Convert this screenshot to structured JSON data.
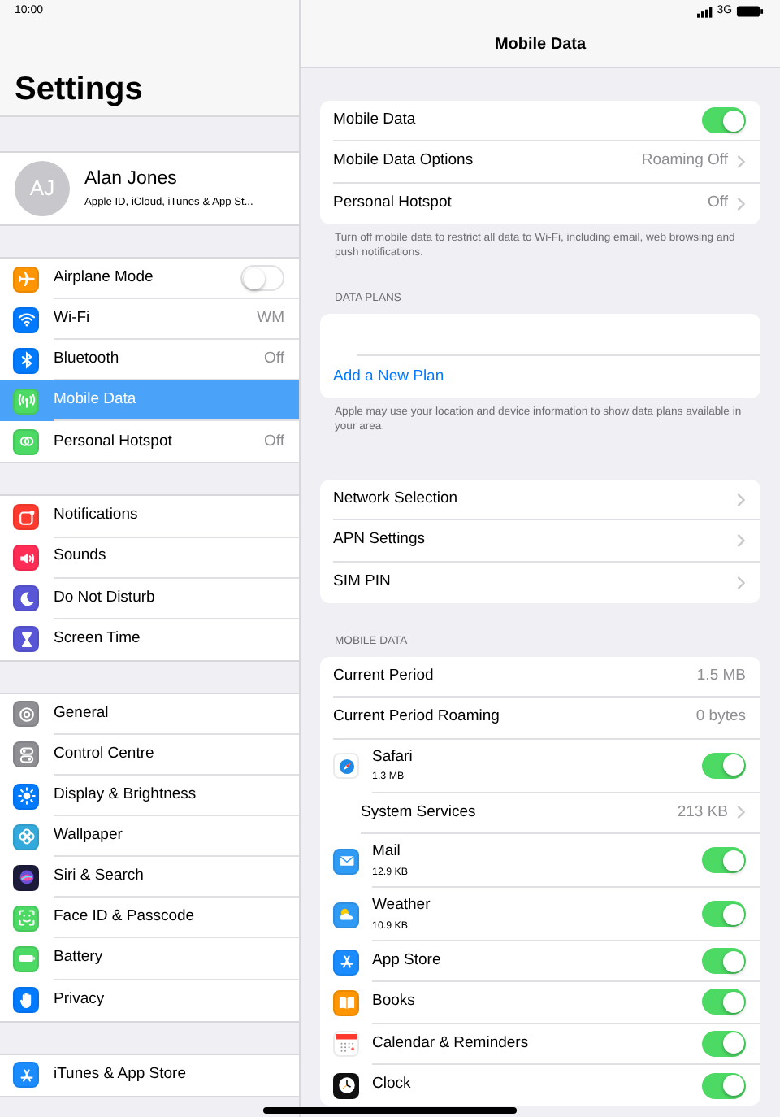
{
  "status_bar": {
    "time": "10:00",
    "network": "3G"
  },
  "sidebar": {
    "title": "Settings",
    "profile": {
      "initials": "AJ",
      "name": "Alan Jones",
      "subtitle": "Apple ID, iCloud, iTunes & App St..."
    },
    "groups": [
      [
        {
          "label": "Airplane Mode",
          "kind": "toggle",
          "on": false,
          "selected": false,
          "color": "#ff9500"
        },
        {
          "label": "Wi-Fi",
          "kind": "link",
          "value": "WM",
          "selected": false,
          "color": "#007aff"
        },
        {
          "label": "Bluetooth",
          "kind": "link",
          "value": "Off",
          "selected": false,
          "color": "#007aff"
        },
        {
          "label": "Mobile Data",
          "kind": "link",
          "selected": true,
          "color": "#4cd964"
        },
        {
          "label": "Personal Hotspot",
          "kind": "link",
          "value": "Off",
          "selected": false,
          "color": "#4cd964"
        }
      ],
      [
        {
          "label": "Notifications",
          "kind": "link",
          "selected": false,
          "color": "#ff3b30"
        },
        {
          "label": "Sounds",
          "kind": "link",
          "selected": false,
          "color": "#ff2d55"
        },
        {
          "label": "Do Not Disturb",
          "kind": "link",
          "selected": false,
          "color": "#5856d6"
        },
        {
          "label": "Screen Time",
          "kind": "link",
          "selected": false,
          "color": "#5856d6"
        }
      ],
      [
        {
          "label": "General",
          "kind": "link",
          "selected": false,
          "color": "#8e8e93"
        },
        {
          "label": "Control Centre",
          "kind": "link",
          "selected": false,
          "color": "#8e8e93"
        },
        {
          "label": "Display & Brightness",
          "kind": "link",
          "selected": false,
          "color": "#007aff"
        },
        {
          "label": "Wallpaper",
          "kind": "link",
          "selected": false,
          "color": "#34aadc"
        },
        {
          "label": "Siri & Search",
          "kind": "link",
          "selected": false,
          "color": "#1c1c3a"
        },
        {
          "label": "Face ID & Passcode",
          "kind": "link",
          "selected": false,
          "color": "#4cd964"
        },
        {
          "label": "Battery",
          "kind": "link",
          "selected": false,
          "color": "#4cd964"
        },
        {
          "label": "Privacy",
          "kind": "link",
          "selected": false,
          "color": "#007aff"
        }
      ],
      [
        {
          "label": "iTunes & App Store",
          "kind": "link",
          "selected": false,
          "color": "#1a8cff"
        }
      ]
    ]
  },
  "detail": {
    "title": "Mobile Data",
    "groups": [
      {
        "rows": [
          {
            "kind": "toggle",
            "label": "Mobile Data",
            "on": true
          },
          {
            "kind": "link",
            "label": "Mobile Data Options",
            "value": "Roaming Off"
          },
          {
            "kind": "link",
            "label": "Personal Hotspot",
            "value": "Off"
          }
        ],
        "footer": "Turn off mobile data to restrict all data to Wi-Fi, including email, web browsing and push notifications."
      },
      {
        "header": "DATA PLANS",
        "rows": [
          {
            "kind": "blank"
          },
          {
            "kind": "action",
            "label": "Add a New Plan"
          }
        ],
        "footer": "Apple may use your location and device information to show data plans available in your area."
      },
      {
        "rows": [
          {
            "kind": "link",
            "label": "Network Selection"
          },
          {
            "kind": "link",
            "label": "APN Settings"
          },
          {
            "kind": "link",
            "label": "SIM PIN"
          }
        ]
      },
      {
        "header": "MOBILE DATA",
        "rows": [
          {
            "kind": "info",
            "label": "Current Period",
            "value": "1.5 MB"
          },
          {
            "kind": "info",
            "label": "Current Period Roaming",
            "value": "0 bytes"
          },
          {
            "kind": "app",
            "label": "Safari",
            "usage": "1.3 MB",
            "on": true,
            "color": "#ffffff"
          },
          {
            "kind": "sublink",
            "label": "System Services",
            "value": "213 KB"
          },
          {
            "kind": "app",
            "label": "Mail",
            "usage": "12.9 KB",
            "on": true,
            "color": "#2f9bf5"
          },
          {
            "kind": "app",
            "label": "Weather",
            "usage": "10.9 KB",
            "on": true,
            "color": "#2f9bf5"
          },
          {
            "kind": "app",
            "label": "App Store",
            "on": true,
            "color": "#1a8cff"
          },
          {
            "kind": "app",
            "label": "Books",
            "on": true,
            "color": "#ff9500"
          },
          {
            "kind": "app",
            "label": "Calendar & Reminders",
            "on": true,
            "color": "#ffffff"
          },
          {
            "kind": "app",
            "label": "Clock",
            "on": true,
            "color": "#111111"
          }
        ]
      }
    ]
  }
}
